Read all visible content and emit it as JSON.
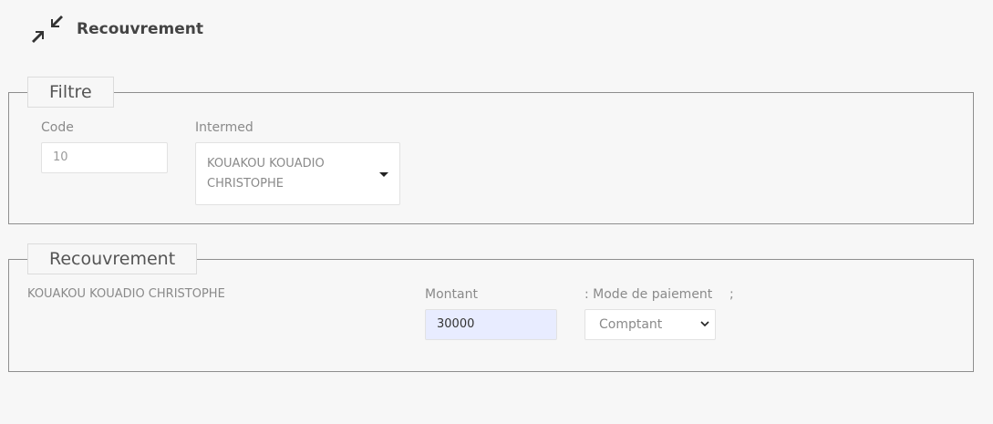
{
  "header": {
    "title": "Recouvrement",
    "icon": "compress-arrows-icon"
  },
  "filtre": {
    "legend": "Filtre",
    "code_label": "Code",
    "code_value": "10",
    "intermed_label": "Intermed",
    "intermed_value": "KOUAKOU KOUADIO CHRISTOPHE"
  },
  "recouvrement": {
    "legend": "Recouvrement",
    "client_name": "KOUAKOU KOUADIO CHRISTOPHE",
    "montant_label": "Montant",
    "montant_value": "30000",
    "mode_label": ": Mode de paiement",
    "separator": ";",
    "mode_value": "Comptant"
  },
  "colors": {
    "montant_bg": "#e8ecff",
    "border": "#8e8e8e"
  }
}
